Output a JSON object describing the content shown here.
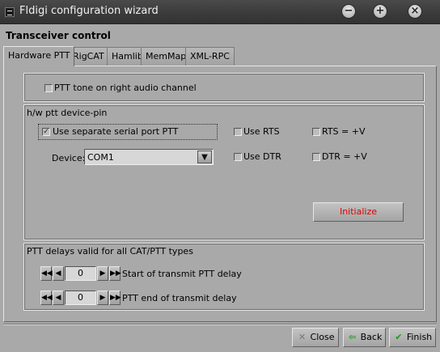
{
  "window": {
    "title": "Fldigi configuration wizard",
    "controls": {
      "minimize": "−",
      "maximize": "+",
      "close": "×"
    }
  },
  "section_title": "Transceiver control",
  "tabs": [
    {
      "label": "Hardware PTT",
      "active": true
    },
    {
      "label": "RigCAT",
      "active": false
    },
    {
      "label": "Hamlib",
      "active": false
    },
    {
      "label": "MemMap",
      "active": false
    },
    {
      "label": "XML-RPC",
      "active": false
    }
  ],
  "ptt_tone": {
    "label": "PTT tone on right audio channel",
    "checked": false
  },
  "hw_ptt": {
    "group_label": "h/w ptt device-pin",
    "use_serial": {
      "label": "Use separate serial port PTT",
      "checked": true
    },
    "use_rts": {
      "label": "Use RTS",
      "checked": false
    },
    "rts_v": {
      "label": "RTS = +V",
      "checked": false
    },
    "use_dtr": {
      "label": "Use DTR",
      "checked": false
    },
    "dtr_v": {
      "label": "DTR = +V",
      "checked": false
    },
    "device_label": "Device:",
    "device_value": "COM1",
    "initialize_label": "Initialize",
    "initialize_color": "#e00000"
  },
  "delays": {
    "group_label": "PTT delays valid for all CAT/PTT types",
    "start": {
      "label": "Start of transmit PTT delay",
      "value": "0"
    },
    "end": {
      "label": "PTT end of transmit delay",
      "value": "0"
    }
  },
  "footer": {
    "close_label": "Close",
    "back_label": "Back",
    "finish_label": "Finish",
    "close_icon": "x-icon",
    "back_icon": "arrow-left-icon",
    "finish_icon": "checkmark-icon"
  },
  "colors": {
    "close_icon": "#777777",
    "back_icon": "#1e9a1e",
    "finish_icon": "#1e9a1e"
  }
}
